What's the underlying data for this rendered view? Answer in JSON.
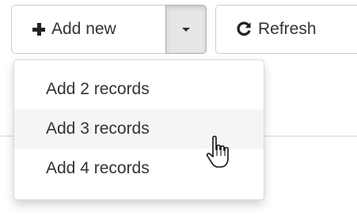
{
  "toolbar": {
    "add_label": "Add new",
    "refresh_label": "Refresh"
  },
  "dropdown": {
    "items": [
      {
        "label": "Add 2 records"
      },
      {
        "label": "Add 3 records"
      },
      {
        "label": "Add 4 records"
      }
    ],
    "hovered_index": 1
  },
  "icons": {
    "add": "plus-icon",
    "toggle": "caret-down-icon",
    "refresh": "refresh-icon",
    "cursor": "hand-pointer-cursor"
  },
  "colors": {
    "active_toggle_bg": "#e6e6e6",
    "hover_item_bg": "#f5f5f5",
    "text": "#333333"
  }
}
